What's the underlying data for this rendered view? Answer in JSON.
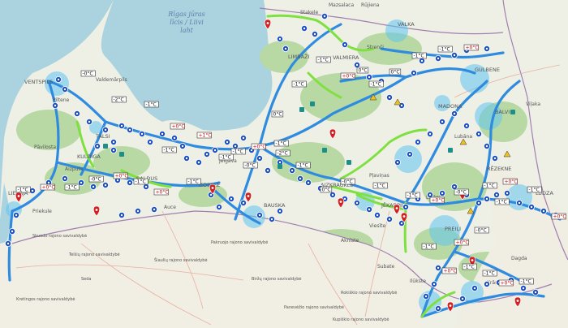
{
  "sea_labels": {
    "gulf_line1": "Rīgas jūras",
    "gulf_line2": "līcis / Liivi",
    "gulf_line3": "laht"
  },
  "place_labels": [
    {
      "id": "stakele",
      "text": "Stakele"
    },
    {
      "id": "mazsalaca",
      "text": "Mazsalaca"
    },
    {
      "id": "rujiena",
      "text": "Rūjiena"
    },
    {
      "id": "valka",
      "text": "VALKA"
    },
    {
      "id": "valmiera",
      "text": "VALMIERA"
    },
    {
      "id": "limbazi",
      "text": "LIMBAŽI"
    },
    {
      "id": "strenci",
      "text": "Strenči"
    },
    {
      "id": "gulbene",
      "text": "GULBENE"
    },
    {
      "id": "valdemarpils",
      "text": "Valdemārpils"
    },
    {
      "id": "piltene",
      "text": "Piltene"
    },
    {
      "id": "ventspils",
      "text": "VENTSPILS"
    },
    {
      "id": "talsi",
      "text": "TALSI"
    },
    {
      "id": "pavilosta",
      "text": "Pāvilosta"
    },
    {
      "id": "kuldiga",
      "text": "KULDĪGA"
    },
    {
      "id": "saldus",
      "text": "SALDUS"
    },
    {
      "id": "aizpute",
      "text": "Aizpute"
    },
    {
      "id": "dobele",
      "text": "DOBELE"
    },
    {
      "id": "auce",
      "text": "Auce"
    },
    {
      "id": "priekule",
      "text": "Priekule"
    },
    {
      "id": "liepaja",
      "text": "LIEPĀJA"
    },
    {
      "id": "jelgava",
      "text": "Jelgava"
    },
    {
      "id": "bauska",
      "text": "BAUSKA"
    },
    {
      "id": "aizkraukle",
      "text": "AIZKRAUKLE"
    },
    {
      "id": "plavinas",
      "text": "Pļaviņas"
    },
    {
      "id": "madona",
      "text": "MADONA"
    },
    {
      "id": "balvi",
      "text": "BALVI"
    },
    {
      "id": "vilaka",
      "text": "Viļaka"
    },
    {
      "id": "lubana",
      "text": "Lubāna"
    },
    {
      "id": "rezekne",
      "text": "RĒZEKNE"
    },
    {
      "id": "ludza",
      "text": "LUDZA"
    },
    {
      "id": "preili",
      "text": "PREIĻI"
    },
    {
      "id": "jekabpils",
      "text": "JĒKABPILS"
    },
    {
      "id": "livani",
      "text": "Līvāni"
    },
    {
      "id": "viesite",
      "text": "Viesīte"
    },
    {
      "id": "subate",
      "text": "Subate"
    },
    {
      "id": "dagda",
      "text": "Dagda"
    },
    {
      "id": "kraslava",
      "text": "Krāslava"
    },
    {
      "id": "ilukste",
      "text": "Ilūkste"
    },
    {
      "id": "aknistes",
      "text": "Aknīste"
    },
    {
      "id": "rokiskis",
      "text": "Rokiškio rajono savivaldybė"
    },
    {
      "id": "birzai",
      "text": "Biržų rajono savivaldybė"
    },
    {
      "id": "telsiai",
      "text": "Telšių rajono savivaldybė"
    },
    {
      "id": "siauliai",
      "text": "Šiaulių rajono savivaldybė"
    },
    {
      "id": "pakruojis",
      "text": "Pakruojo rajono savivaldybė"
    },
    {
      "id": "panevezys",
      "text": "Panevėžio rajono savivaldybė"
    },
    {
      "id": "kupiskis",
      "text": "Kupiškio rajono savivaldybė"
    },
    {
      "id": "skuodas",
      "text": "Skuodo rajono savivaldybė"
    },
    {
      "id": "kretinga",
      "text": "Kretingos rajono savivaldybė"
    },
    {
      "id": "seda",
      "text": "Seda"
    }
  ],
  "temperatures": [
    "-0°C",
    "-2°C",
    "-1°C",
    "+0°C",
    "+1°C",
    "-1°C",
    "0°C",
    "-1°C",
    "-1°C",
    "+0°C",
    "-1°C",
    "0°C",
    "-1°C",
    "-1°C",
    "+0°C",
    "-1°C",
    "-1°C",
    "-1°C",
    "+0°C",
    "-2°C",
    "-1°C",
    "0°C",
    "-0°C",
    "-1°C",
    "-1°C",
    "+0°C",
    "-0°C",
    "-1°C",
    "+0°C",
    "-1°C",
    "+0°C",
    "-1°C",
    "-0°C",
    "+0°C",
    "-1°C",
    "+0°C",
    "-1°C",
    "-1°C",
    "+0°C",
    "-1°C",
    "-1°C",
    "+0°C",
    "-1°C",
    "-0°C",
    "+0°C",
    "-1°C",
    "+0°C",
    "-0°C",
    "-1°C",
    "0°C"
  ],
  "colors": {
    "sea": "#aad3df",
    "land": "#eef0e6",
    "forest": "#b8d9a3",
    "road_blue": "#2f8be0",
    "road_green": "#7fe040",
    "heat_circle": "#5fc4f0",
    "border": "#a07fb0",
    "warning_red": "#d42020"
  },
  "icon_names": [
    "camera-pin-icon",
    "weather-station-icon",
    "snowflake-icon",
    "warning-pin-icon",
    "truck-icon",
    "road-sign-icon"
  ]
}
